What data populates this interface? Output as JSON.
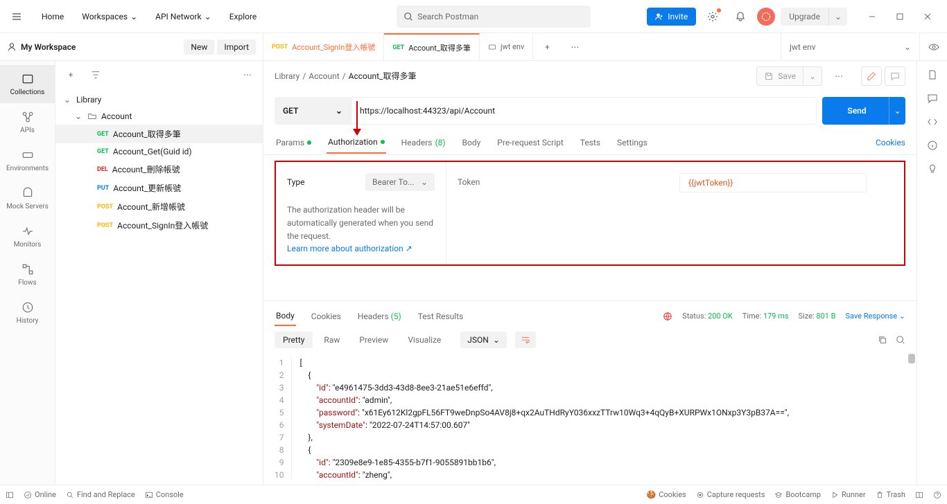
{
  "topbar": {
    "nav": [
      "Home",
      "Workspaces",
      "API Network",
      "Explore"
    ],
    "search_placeholder": "Search Postman",
    "invite": "Invite",
    "upgrade": "Upgrade"
  },
  "workspace": {
    "name": "My Workspace",
    "new": "New",
    "import": "Import"
  },
  "tabs": [
    {
      "method": "POST",
      "label": "Account_SignIn登入帳號"
    },
    {
      "method": "GET",
      "label": "Account_取得多筆"
    },
    {
      "method": "",
      "label": "jwt env",
      "icon": "env"
    }
  ],
  "env_selector": "jwt env",
  "rail": {
    "collections": "Collections",
    "apis": "APIs",
    "environments": "Environments",
    "mock": "Mock Servers",
    "monitors": "Monitors",
    "flows": "Flows",
    "history": "History"
  },
  "tree": {
    "root": "Library",
    "folder": "Account",
    "items": [
      {
        "method": "GET",
        "label": "Account_取得多筆"
      },
      {
        "method": "GET",
        "label": "Account_Get(Guid id)"
      },
      {
        "method": "DEL",
        "label": "Account_刪除帳號"
      },
      {
        "method": "PUT",
        "label": "Account_更新帳號"
      },
      {
        "method": "POST",
        "label": "Account_新增帳號"
      },
      {
        "method": "POST",
        "label": "Account_SignIn登入帳號"
      }
    ]
  },
  "breadcrumb": {
    "library": "Library",
    "account": "Account",
    "current": "Account_取得多筆"
  },
  "save": "Save",
  "request": {
    "method": "GET",
    "url": "https://localhost:44323/api/Account",
    "send": "Send"
  },
  "req_tabs": {
    "params": "Params",
    "authorization": "Authorization",
    "headers": "Headers",
    "headers_count": "(8)",
    "body": "Body",
    "prereq": "Pre-request Script",
    "tests": "Tests",
    "settings": "Settings",
    "cookies": "Cookies"
  },
  "auth": {
    "type_label": "Type",
    "type_value": "Bearer To...",
    "desc": "The authorization header will be automatically generated when you send the request.",
    "learn": "Learn more about authorization",
    "token_label": "Token",
    "token_value": "{{jwtToken}}"
  },
  "resp_tabs": {
    "body": "Body",
    "cookies": "Cookies",
    "headers": "Headers",
    "headers_count": "(5)",
    "tests": "Test Results"
  },
  "resp_meta": {
    "status_label": "Status:",
    "status_value": "200 OK",
    "time_label": "Time:",
    "time_value": "179 ms",
    "size_label": "Size:",
    "size_value": "801 B",
    "save": "Save Response"
  },
  "resp_views": {
    "pretty": "Pretty",
    "raw": "Raw",
    "preview": "Preview",
    "visualize": "Visualize",
    "format": "JSON"
  },
  "code_lines": [
    "[",
    "    {",
    "        \"id\": \"e4961475-3dd3-43d8-8ee3-21ae51e6effd\",",
    "        \"accountId\": \"admin\",",
    "        \"password\": \"x61Ey612Kl2gpFL56FT9weDnpSo4AV8j8+qx2AuTHdRyY036xxzTTrw10Wq3+4qQyB+XURPWx1ONxp3Y3pB37A==\",",
    "        \"systemDate\": \"2022-07-24T14:57:00.607\"",
    "    },",
    "    {",
    "        \"id\": \"2309e8e9-1e85-4355-b7f1-9055891bb1b6\",",
    "        \"accountId\": \"zheng\","
  ],
  "statusbar": {
    "online": "Online",
    "find": "Find and Replace",
    "console": "Console",
    "cookies": "Cookies",
    "capture": "Capture requests",
    "bootcamp": "Bootcamp",
    "runner": "Runner",
    "trash": "Trash"
  }
}
